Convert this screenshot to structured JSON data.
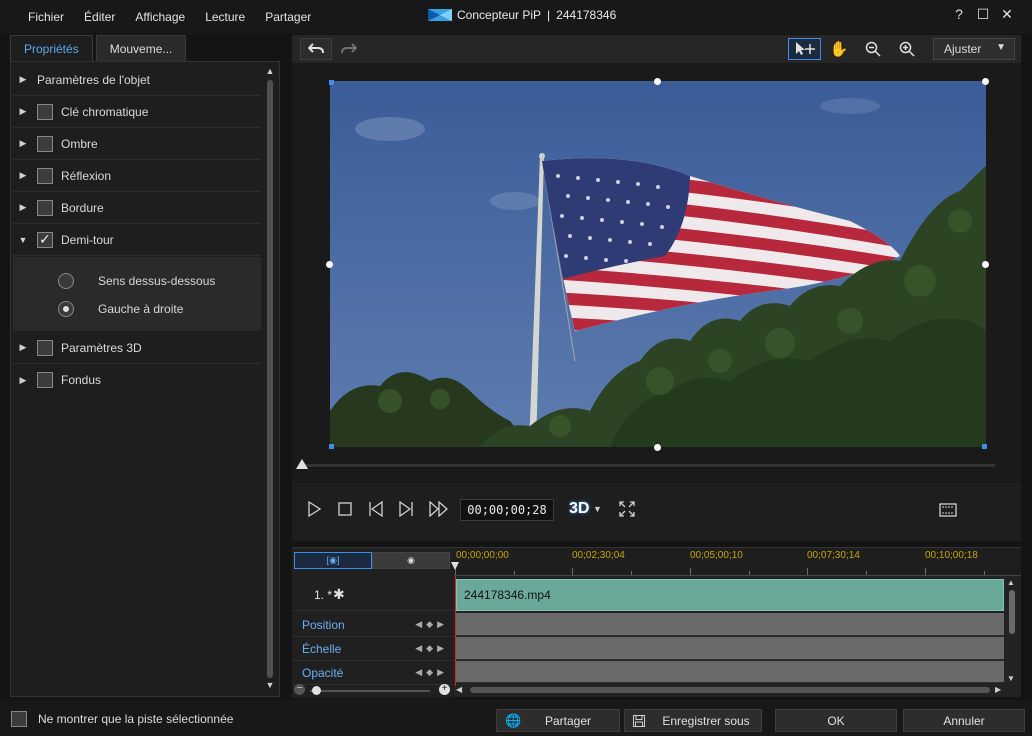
{
  "menu": [
    "Fichier",
    "Éditer",
    "Affichage",
    "Lecture",
    "Partager"
  ],
  "window": {
    "title": "Concepteur PiP",
    "separator": "|",
    "file_id": "244178346"
  },
  "window_controls": {
    "help": "?",
    "maximize": "☐",
    "close": "✕"
  },
  "tabs": [
    {
      "label": "Propriétés",
      "active": true
    },
    {
      "label": "Mouveme...",
      "active": false
    }
  ],
  "properties": {
    "items": [
      {
        "label": "Paramètres de l'objet",
        "has_checkbox": false,
        "expanded": false
      },
      {
        "label": "Clé chromatique",
        "has_checkbox": true,
        "checked": false,
        "expanded": false
      },
      {
        "label": "Ombre",
        "has_checkbox": true,
        "checked": false,
        "expanded": false
      },
      {
        "label": "Réflexion",
        "has_checkbox": true,
        "checked": false,
        "expanded": false
      },
      {
        "label": "Bordure",
        "has_checkbox": true,
        "checked": false,
        "expanded": false
      },
      {
        "label": "Demi-tour",
        "has_checkbox": true,
        "checked": true,
        "expanded": true
      },
      {
        "label": "Paramètres 3D",
        "has_checkbox": true,
        "checked": false,
        "expanded": false
      },
      {
        "label": "Fondus",
        "has_checkbox": true,
        "checked": false,
        "expanded": false
      }
    ],
    "flip_options": [
      {
        "label": "Sens dessus-dessous",
        "selected": false
      },
      {
        "label": "Gauche à droite",
        "selected": true
      }
    ]
  },
  "preview_toolbar": {
    "fit_label": "Ajuster"
  },
  "playback": {
    "timecode": "00;00;00;28",
    "three_d_label": "3D"
  },
  "timeline": {
    "ruler": [
      "00;00;00;00",
      "00;02;30;04",
      "00;05;00;10",
      "00;07;30;14",
      "00;10;00;18"
    ],
    "track_label": "1. *",
    "clip_name": "244178346.mp4",
    "keyframe_rows": [
      "Position",
      "Échelle",
      "Opacité"
    ]
  },
  "footer": {
    "show_selected_label": "Ne montrer que la piste sélectionnée",
    "share_label": "Partager",
    "save_as_label": "Enregistrer sous",
    "ok_label": "OK",
    "cancel_label": "Annuler"
  },
  "colors": {
    "accent": "#3d8ee8",
    "clip": "#6aa89a",
    "ruler_text": "#c8a400",
    "playhead": "#d62828"
  }
}
